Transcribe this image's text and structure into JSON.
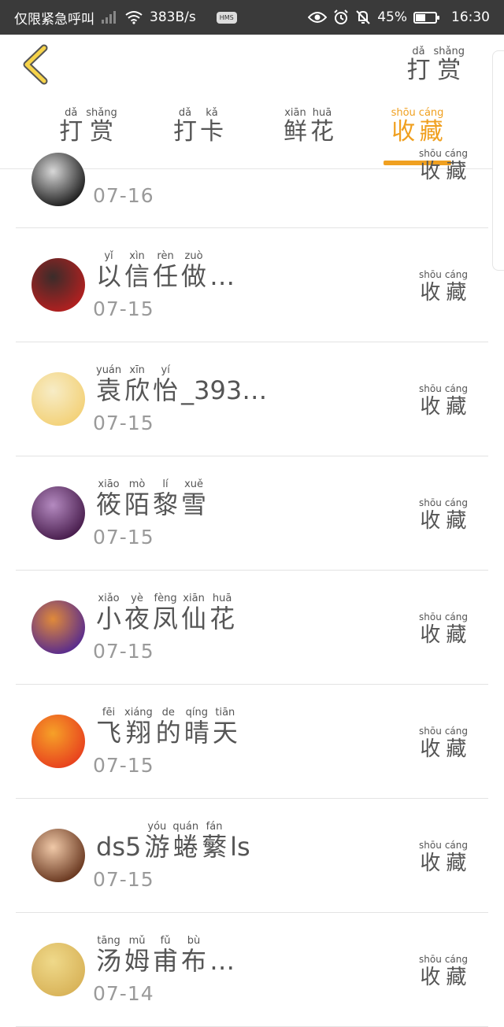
{
  "status_bar": {
    "left_text": "仅限紧急呼叫",
    "network_speed": "383B/s",
    "hms": "HMS",
    "battery": "45%",
    "battery_level": 0.45,
    "time": "16:30"
  },
  "header": {
    "reward_label": {
      "py": [
        "dǎ",
        "shǎng"
      ],
      "hz": [
        "打",
        "赏"
      ]
    }
  },
  "tabs": [
    {
      "py": [
        "dǎ",
        "shǎng"
      ],
      "hz": [
        "打",
        "赏"
      ],
      "active": false
    },
    {
      "py": [
        "dǎ",
        "kǎ"
      ],
      "hz": [
        "打",
        "卡"
      ],
      "active": false
    },
    {
      "py": [
        "xiān",
        "huā"
      ],
      "hz": [
        "鲜",
        "花"
      ],
      "active": false
    },
    {
      "py": [
        "shōu",
        "cáng"
      ],
      "hz": [
        "收",
        "藏"
      ],
      "active": true
    }
  ],
  "fav_label": {
    "py": [
      "shōu",
      "cáng"
    ],
    "hz": [
      "收",
      "藏"
    ]
  },
  "rows": [
    {
      "name_parts": [],
      "date": "07-16",
      "avatar_colors": [
        "#222222",
        "#d8d8d8"
      ]
    },
    {
      "name_parts": [
        {
          "py": "yǐ",
          "hz": "以"
        },
        {
          "py": "xìn",
          "hz": "信"
        },
        {
          "py": "rèn",
          "hz": "任"
        },
        {
          "py": "zuò",
          "hz": "做"
        },
        {
          "py": "",
          "hz": "…"
        }
      ],
      "date": "07-15",
      "avatar_colors": [
        "#b02020",
        "#3a2c2a"
      ]
    },
    {
      "name_parts": [
        {
          "py": "yuán",
          "hz": "袁"
        },
        {
          "py": "xīn",
          "hz": "欣"
        },
        {
          "py": "yí",
          "hz": "怡"
        },
        {
          "py": "",
          "hz": "_393…"
        }
      ],
      "date": "07-15",
      "avatar_colors": [
        "#f3d27a",
        "#f7ecc6"
      ]
    },
    {
      "name_parts": [
        {
          "py": "xiāo",
          "hz": "筱"
        },
        {
          "py": "mò",
          "hz": "陌"
        },
        {
          "py": "lí",
          "hz": "黎"
        },
        {
          "py": "xuě",
          "hz": "雪"
        }
      ],
      "date": "07-15",
      "avatar_colors": [
        "#4a1f4f",
        "#b48ac0"
      ]
    },
    {
      "name_parts": [
        {
          "py": "xiǎo",
          "hz": "小"
        },
        {
          "py": "yè",
          "hz": "夜"
        },
        {
          "py": "fèng",
          "hz": "凤"
        },
        {
          "py": "xiān",
          "hz": "仙"
        },
        {
          "py": "huā",
          "hz": "花"
        }
      ],
      "date": "07-15",
      "avatar_colors": [
        "#5b2d8c",
        "#e08a3a"
      ]
    },
    {
      "name_parts": [
        {
          "py": "fēi",
          "hz": "飞"
        },
        {
          "py": "xiáng",
          "hz": "翔"
        },
        {
          "py": "de",
          "hz": "的"
        },
        {
          "py": "qíng",
          "hz": "晴"
        },
        {
          "py": "tiān",
          "hz": "天"
        }
      ],
      "date": "07-15",
      "avatar_colors": [
        "#e8431e",
        "#f6a128"
      ]
    },
    {
      "name_parts": [
        {
          "py": "",
          "hz": "ds5"
        },
        {
          "py": "yóu",
          "hz": "游"
        },
        {
          "py": "quán",
          "hz": "蜷"
        },
        {
          "py": "fán",
          "hz": "蘩"
        },
        {
          "py": "",
          "hz": "ls"
        }
      ],
      "date": "07-15",
      "avatar_colors": [
        "#6b3a22",
        "#f0c9a8"
      ]
    },
    {
      "name_parts": [
        {
          "py": "tāng",
          "hz": "汤"
        },
        {
          "py": "mǔ",
          "hz": "姆"
        },
        {
          "py": "fǔ",
          "hz": "甫"
        },
        {
          "py": "bù",
          "hz": "布"
        },
        {
          "py": "",
          "hz": "…"
        }
      ],
      "date": "07-14",
      "avatar_colors": [
        "#d9b45a",
        "#efd98a"
      ]
    }
  ]
}
